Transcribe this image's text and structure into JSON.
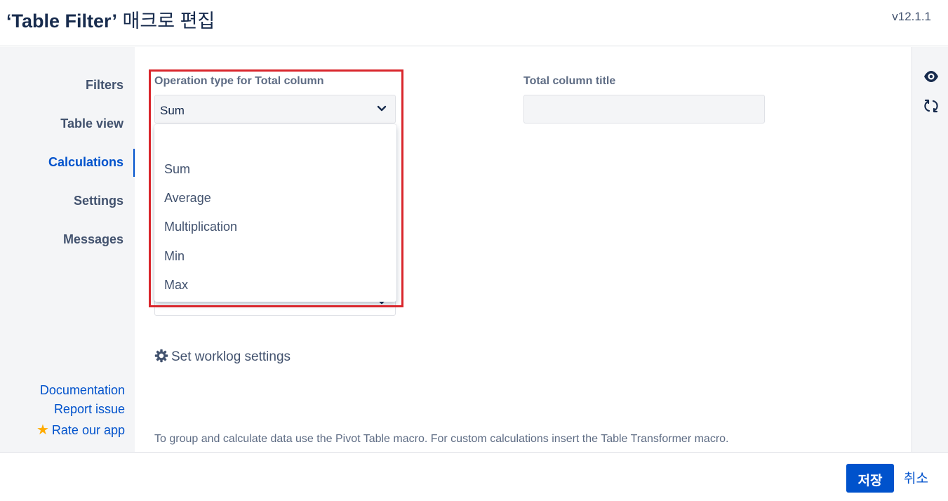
{
  "header": {
    "title_strong": "‘Table Filter’",
    "title_rest": " 매크로 편집",
    "version": "v12.1.1"
  },
  "sidebar": {
    "items": [
      {
        "label": "Filters"
      },
      {
        "label": "Table view"
      },
      {
        "label": "Calculations"
      },
      {
        "label": "Settings"
      },
      {
        "label": "Messages"
      }
    ],
    "active": "Calculations",
    "links": {
      "documentation": "Documentation",
      "report_issue": "Report issue",
      "rate_app": "Rate our app"
    }
  },
  "main": {
    "operation_label": "Operation type for Total column",
    "operation_value": "Sum",
    "operation_options": [
      "",
      "Sum",
      "Average",
      "Multiplication",
      "Min",
      "Max"
    ],
    "total_title_label": "Total column title",
    "total_title_value": "",
    "worklog_label": "Set worklog settings",
    "hint": "To group and calculate data use the Pivot Table macro. For custom calculations insert the Table Transformer macro."
  },
  "rightbar": {
    "icons": [
      "eye-icon",
      "refresh-icon"
    ]
  },
  "footer": {
    "save_label": "저장",
    "cancel_label": "취소"
  },
  "colors": {
    "accent": "#0052cc",
    "highlight": "#d9262c",
    "star": "#ffab00"
  }
}
